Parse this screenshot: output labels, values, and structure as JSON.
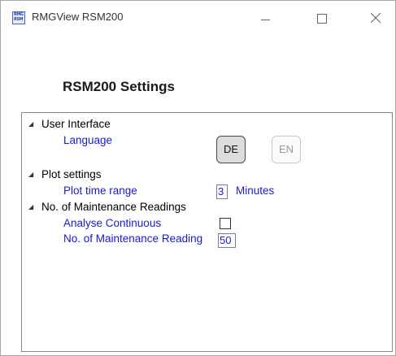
{
  "window": {
    "title": "RMGView RSM200",
    "icon_top": "RMG",
    "icon_bottom": "RSM"
  },
  "page": {
    "heading": "RSM200 Settings"
  },
  "groups": {
    "user_interface": {
      "label": "User Interface",
      "language_label": "Language",
      "language_options": [
        "DE",
        "EN"
      ],
      "selected_language": "DE"
    },
    "plot_settings": {
      "label": "Plot settings",
      "plot_time_range_label": "Plot time range",
      "plot_time_range_value": "3",
      "plot_time_range_unit": "Minutes"
    },
    "maintenance": {
      "label": "No. of Maintenance Readings",
      "analyse_continuous_label": "Analyse Continuous",
      "analyse_continuous_checked": false,
      "readings_label": "No. of Maintenance Reading",
      "readings_value": "50"
    }
  },
  "icons": {
    "expand_glyph": "◢",
    "close_icon": "close-icon",
    "minimize_icon": "minimize-icon",
    "maximize_icon": "maximize-icon"
  },
  "colors": {
    "property_label": "#1a1acc",
    "group_label": "#000000"
  }
}
